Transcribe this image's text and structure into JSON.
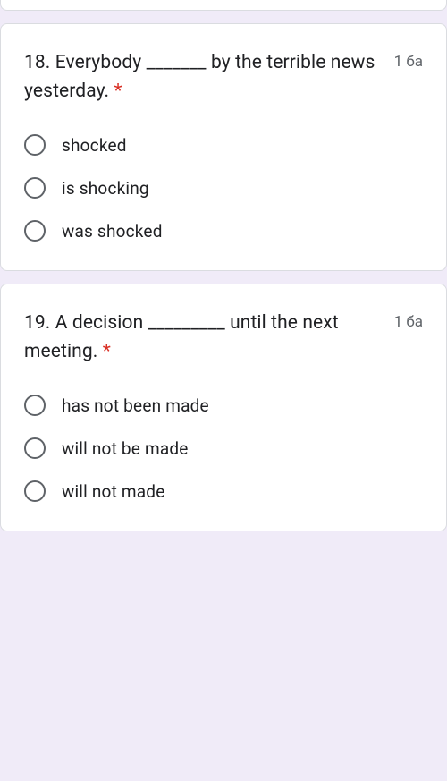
{
  "questions": [
    {
      "number": "18.",
      "text_before": "Everybody ",
      "blank": "_______",
      "text_after": " by the terrible news yesterday.",
      "required_marker": "*",
      "points": "1 ба",
      "options": [
        {
          "label": "shocked"
        },
        {
          "label": "is shocking"
        },
        {
          "label": "was shocked"
        }
      ]
    },
    {
      "number": "19.",
      "text_before": "A decision ",
      "blank": "_________",
      "text_after": " until the next meeting.",
      "required_marker": "*",
      "points": "1 ба",
      "options": [
        {
          "label": "has not been made"
        },
        {
          "label": "will not be made"
        },
        {
          "label": "will not made"
        }
      ]
    }
  ]
}
